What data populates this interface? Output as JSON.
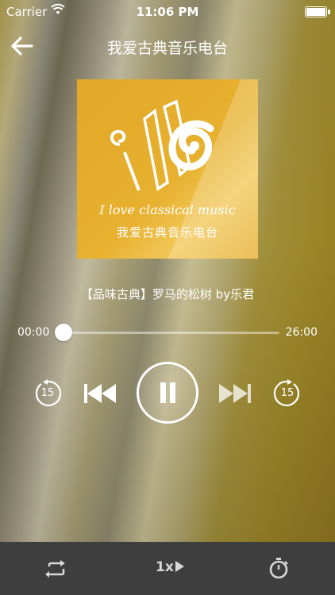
{
  "status_bar": {
    "carrier": "Carrier",
    "time": "11:06 PM",
    "icons": [
      "wifi-icon",
      "battery-icon"
    ]
  },
  "nav": {
    "title": "我爱古典音乐电台",
    "back_icon": "arrow-left-icon"
  },
  "album": {
    "english_text": "I love classical music",
    "chinese_text": "我爱古典音乐电台"
  },
  "track": {
    "title": "【品味古典】罗马的松树 by乐君"
  },
  "progress": {
    "current": "00:00",
    "total": "26:00",
    "fraction": 0.03
  },
  "controls": {
    "rewind_label": "15",
    "forward_label": "15",
    "state": "playing"
  },
  "bottom_bar": {
    "speed_label": "1x",
    "icons": [
      "repeat-icon",
      "play-speed-icon",
      "timer-icon"
    ]
  },
  "colors": {
    "album_bg": "#e4aa28",
    "bottom_bar": "#3e3e3e",
    "accent": "#ffffff"
  }
}
